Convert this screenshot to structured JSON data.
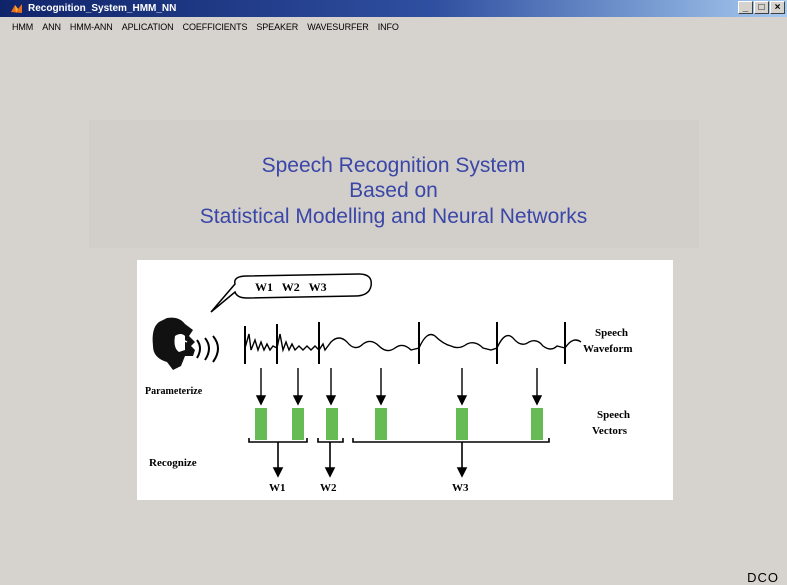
{
  "window": {
    "title": "Recognition_System_HMM_NN",
    "controls": [
      "_",
      "□",
      "×"
    ]
  },
  "menu": [
    "HMM",
    "ANN",
    "HMM-ANN",
    "APLICATION",
    "COEFFICIENTS",
    "SPEAKER",
    "WAVESURFER",
    "INFO"
  ],
  "heading": {
    "line1": "Speech Recognition System",
    "line2": "Based on",
    "line3": "Statistical Modelling  and Neural Networks"
  },
  "figure": {
    "bubble_words": "W1   W2   W3",
    "waveform_label_1": "Speech",
    "waveform_label_2": "Waveform",
    "parameterize_label": "Parameterize",
    "vectors_label_1": "Speech",
    "vectors_label_2": "Vectors",
    "recognize_label": "Recognize",
    "output_w1": "W1",
    "output_w2": "W2",
    "output_w3": "W3",
    "bar_color": "#66bb55"
  },
  "footer": {
    "mark": "DCO"
  },
  "colors": {
    "heading": "#3a46a8",
    "titlebar": "#10246a",
    "background": "#d6d3ce"
  }
}
